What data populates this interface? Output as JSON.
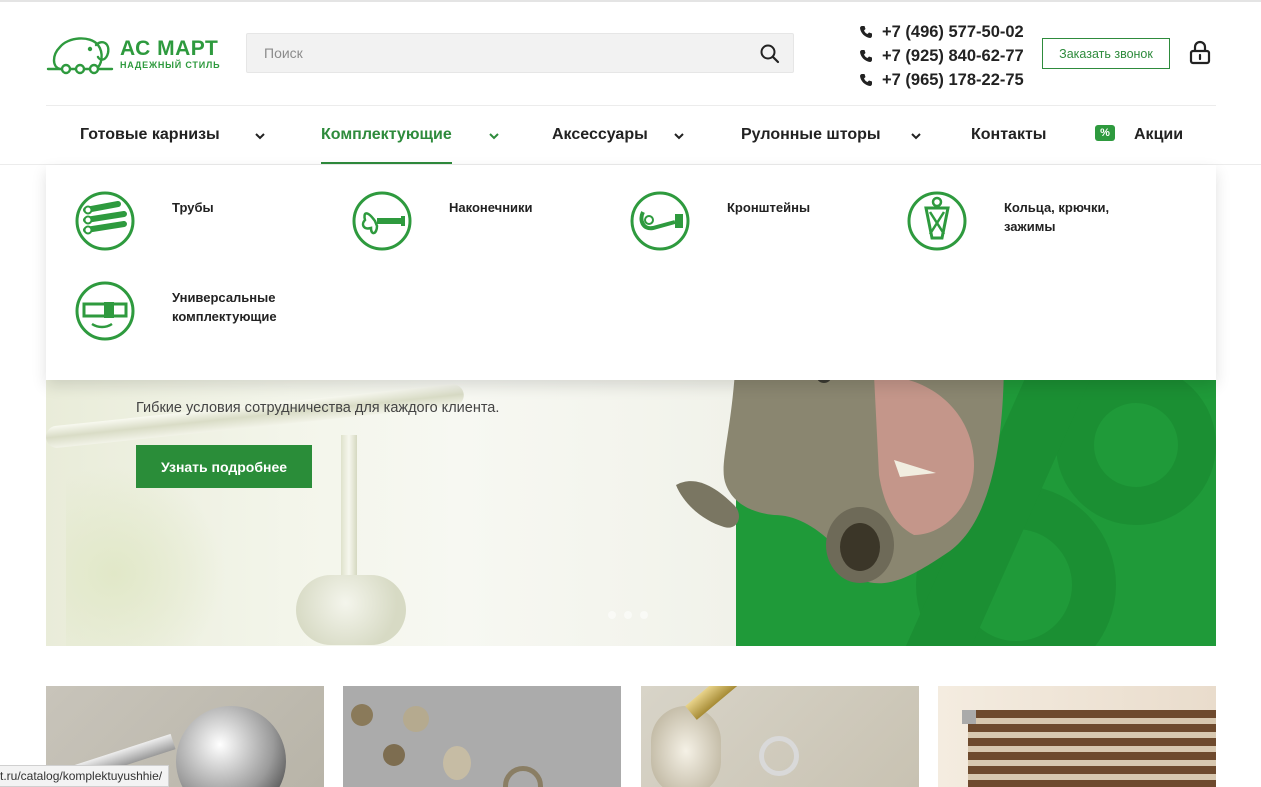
{
  "brand": {
    "name": "АС МАРТ",
    "tagline": "НАДЕЖНЫЙ СТИЛЬ",
    "accent": "#2e8b3c"
  },
  "search": {
    "placeholder": "Поиск"
  },
  "phones": [
    "+7 (496) 577-50-02",
    "+7 (925) 840-62-77",
    "+7 (965) 178-22-75"
  ],
  "header": {
    "callback_label": "Заказать звонок"
  },
  "nav": {
    "items": [
      {
        "label": "Готовые карнизы"
      },
      {
        "label": "Комплектующие"
      },
      {
        "label": "Аксессуары"
      },
      {
        "label": "Рулонные шторы"
      },
      {
        "label": "Контакты"
      },
      {
        "label": "Акции"
      }
    ],
    "promo_icon_label": "%"
  },
  "dropdown": {
    "items": [
      {
        "label": "Трубы",
        "icon": "pipes-icon"
      },
      {
        "label": "Наконечники",
        "icon": "finial-icon"
      },
      {
        "label": "Кронштейны",
        "icon": "bracket-icon"
      },
      {
        "label": "Кольца, крючки, зажимы",
        "icon": "clip-icon"
      },
      {
        "label": "Универсальные комплектующие",
        "icon": "universal-icon"
      }
    ]
  },
  "banner": {
    "subtitle": "Гибкие условия сотрудничества для каждого клиента.",
    "button_label": "Узнать подробнее"
  },
  "status_url": "t.ru/catalog/komplektuyushhie/"
}
